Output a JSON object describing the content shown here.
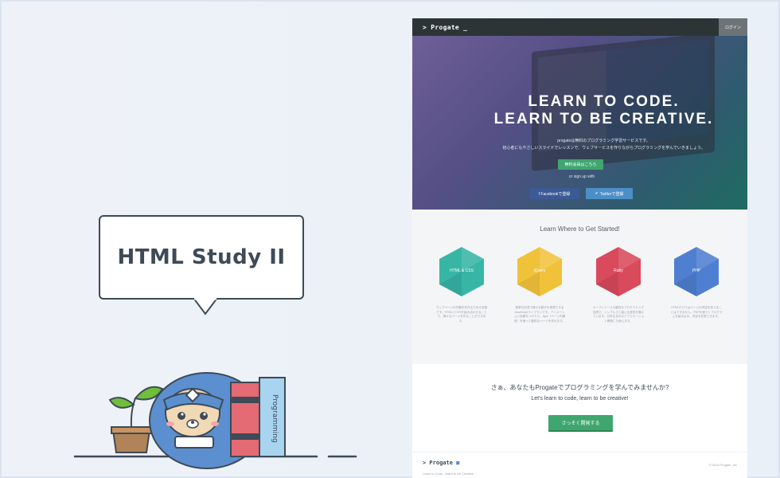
{
  "bubble": {
    "title": "HTML Study II"
  },
  "book": {
    "label": "Programming"
  },
  "site": {
    "logo": "> Progate _",
    "login": "ログイン",
    "hero": {
      "headline_1": "LEARN TO CODE.",
      "headline_2": "LEARN TO BE CREATIVE.",
      "sub_1": "progateは無料のプログラミング学習サービスです。",
      "sub_2": "初心者にもやさしいスライドでレッスンで、ウェブサービスを作りながらプログラミングを学んでいきましょう。",
      "signup_button": "無料会員はこちら",
      "or_signup": "or sign up with",
      "facebook_button": "f Facebookで登録",
      "twitter_button": "Twitterで登録"
    },
    "learn": {
      "title": "Learn Where to Get Started!",
      "courses": [
        {
          "label": "HTML & CSS",
          "color": "#37b6a6",
          "desc": "ウェブページの外観を形作るための言語です。HTMLとCSSを組み合わせることで、様々なページを作ることができます。"
        },
        {
          "label": "jQuery",
          "color": "#f0c23a",
          "desc": "簡単な記述で様々な動きを実現できるJavaScriptライブラリです。アニメーション効果をつけたり、Ajax（ページ内通信）を使って動的なページを作れます。"
        },
        {
          "label": "Ruby",
          "color": "#d94a5c",
          "desc": "オープンソースの動的なプログラミング言語で、シンプルさと高い生産性を備えています。日本生まれのアプリケーション開発にも使えます。"
        },
        {
          "label": "PHP",
          "color": "#4f7fd1",
          "desc": "HTMLだけではページの内容を変えることはできません。PHPを使うとプログラムを組み込み、内容を変更できます。"
        }
      ]
    },
    "cta": {
      "jp": "さぁ、あなたもProgateでプログラミングを学んでみませんか?",
      "en": "Let's learn to code, learn to be creative!",
      "button": "さっそく開発する"
    },
    "footer": {
      "logo": "> Progate",
      "tagline": "Learn to Code, Learn to be Creative.",
      "copyright": "© 2014 Progate, Inc"
    }
  }
}
